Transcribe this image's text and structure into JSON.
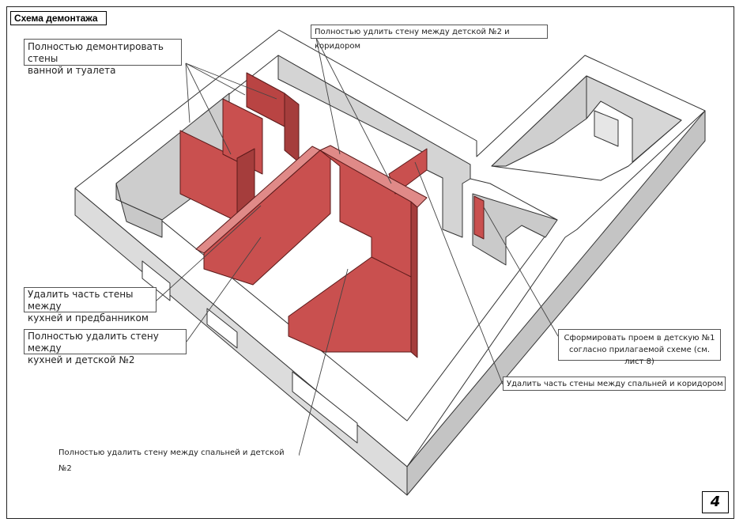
{
  "title": "Схема демонтажа",
  "page_number": "4",
  "notes": {
    "wall_kids2_corridor": "Полностью удлить стену между детской №2 и коридором",
    "bath_toilet_1": "Полностью демонтировать стены",
    "bath_toilet_2": "ванной и туалета",
    "kitchen_hall_1": "Удалить часть стены между",
    "kitchen_hall_2": "кухней и предбанником",
    "kitchen_kids2_1": "Полностью удалить стену между",
    "kitchen_kids2_2": "кухней и детской №2",
    "bedroom_kids2": "Полностью удалить стену между спальней и детской №2",
    "opening_kids1_1": "Сформировать проем в детскую №1",
    "opening_kids1_2": "согласно прилагаемой схеме (см. лист 8)",
    "bedroom_corridor": "Удалить часть стены между спальней и коридором"
  },
  "colors": {
    "demolition": "#c9504f",
    "demolition_dark": "#a53d3c",
    "wall_top": "#ffffff",
    "wall_side": "#cfcfcf",
    "floor": "#ffffff",
    "outline": "#333333"
  }
}
